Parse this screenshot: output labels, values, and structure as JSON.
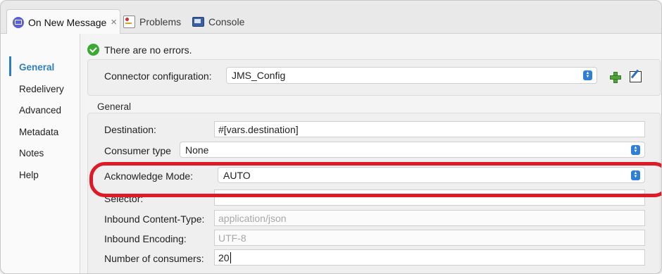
{
  "tabs": [
    {
      "label": "On New Message",
      "close": "×"
    },
    {
      "label": "Problems"
    },
    {
      "label": "Console"
    }
  ],
  "sidebar": {
    "items": [
      {
        "label": "General"
      },
      {
        "label": "Redelivery"
      },
      {
        "label": "Advanced"
      },
      {
        "label": "Metadata"
      },
      {
        "label": "Notes"
      },
      {
        "label": "Help"
      }
    ]
  },
  "status": {
    "text": "There are no errors."
  },
  "connector": {
    "label": "Connector configuration:",
    "value": "JMS_Config"
  },
  "general": {
    "title": "General",
    "destination": {
      "label": "Destination:",
      "value": "#[vars.destination]"
    },
    "consumer_type": {
      "label": "Consumer type",
      "value": "None"
    },
    "ack_mode": {
      "label": "Acknowledge Mode:",
      "value": "AUTO"
    },
    "selector": {
      "label": "Selector:",
      "value": ""
    },
    "content_type": {
      "label": "Inbound Content-Type:",
      "placeholder": "application/json"
    },
    "encoding": {
      "label": "Inbound Encoding:",
      "placeholder": "UTF-8"
    },
    "consumers": {
      "label": "Number of consumers:",
      "value": "20"
    }
  },
  "colors": {
    "accent": "#2d7fc2",
    "highlight": "#e01926",
    "ok": "#3aaa35"
  }
}
